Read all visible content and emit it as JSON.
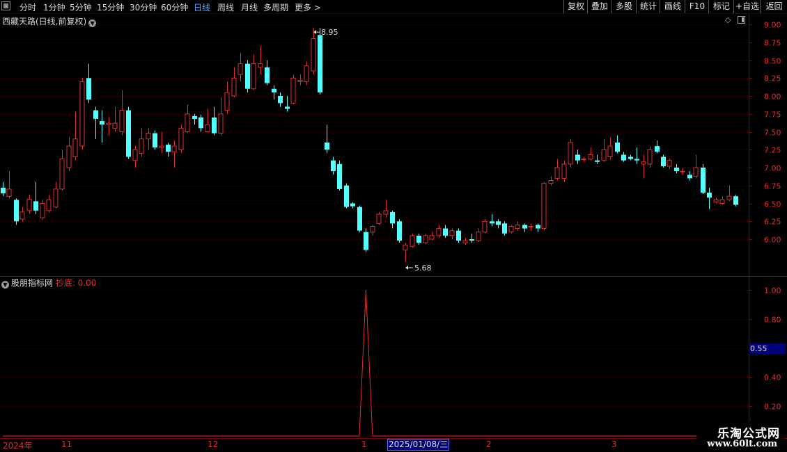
{
  "toolbar": {
    "tabs": [
      "分时",
      "1分钟",
      "5分钟",
      "15分钟",
      "30分钟",
      "60分钟",
      "日线",
      "周线",
      "月线",
      "多周期",
      "更多"
    ],
    "active_tab": "日线",
    "more_arrow": ">",
    "right_buttons": [
      "复权",
      "叠加",
      "多股",
      "统计",
      "画线",
      "F10",
      "标记",
      "+自选",
      "返回"
    ]
  },
  "main_panel": {
    "title": "西藏天路(日线,前复权)",
    "high_label": "8.95",
    "low_label": "5.68"
  },
  "indicator_panel": {
    "name": "股朋指标网",
    "series_label": "抄底:",
    "series_value": "0.00",
    "current_value": "0.55"
  },
  "time_axis": {
    "labels": [
      "2024年",
      "11",
      "12",
      "1",
      "2",
      "3"
    ],
    "cursor_date": "2025/01/08/三"
  },
  "watermark": {
    "line1": "乐淘公式网",
    "line2": "www.60lt.com"
  },
  "chart_data": [
    {
      "type": "candlestick",
      "price_axis_ticks": [
        9.0,
        8.75,
        8.5,
        8.25,
        8.0,
        7.75,
        7.5,
        7.25,
        7.0,
        6.75,
        6.5,
        6.25,
        6.0
      ],
      "ylim": [
        5.5,
        9.05
      ],
      "colors": {
        "up": "#e03030",
        "down": "#54ffff"
      },
      "candles": [
        [
          6.72,
          6.64,
          6.8,
          6.6
        ],
        [
          6.6,
          6.7,
          6.95,
          6.57
        ],
        [
          6.55,
          6.25,
          6.57,
          6.2
        ],
        [
          6.28,
          6.38,
          6.45,
          6.25
        ],
        [
          6.4,
          6.56,
          6.62,
          6.36
        ],
        [
          6.53,
          6.4,
          6.8,
          6.35
        ],
        [
          6.3,
          6.5,
          6.55,
          6.27
        ],
        [
          6.4,
          6.55,
          6.62,
          6.37
        ],
        [
          6.45,
          6.7,
          6.8,
          6.43
        ],
        [
          6.7,
          7.12,
          7.25,
          6.68
        ],
        [
          7.0,
          7.3,
          7.42,
          6.95
        ],
        [
          7.15,
          7.4,
          7.78,
          7.1
        ],
        [
          7.3,
          8.2,
          8.25,
          7.25
        ],
        [
          8.25,
          7.95,
          8.45,
          7.9
        ],
        [
          7.8,
          7.68,
          7.85,
          7.4
        ],
        [
          7.65,
          7.6,
          7.8,
          7.35
        ],
        [
          7.6,
          7.62,
          7.7,
          7.45
        ],
        [
          7.55,
          7.62,
          7.85,
          7.5
        ],
        [
          7.5,
          7.8,
          8.08,
          7.45
        ],
        [
          7.8,
          7.15,
          7.85,
          7.12
        ],
        [
          7.1,
          7.25,
          7.3,
          7.0
        ],
        [
          7.2,
          7.4,
          7.55,
          7.15
        ],
        [
          7.4,
          7.48,
          7.55,
          7.25
        ],
        [
          7.48,
          7.28,
          7.52,
          7.25
        ],
        [
          7.28,
          7.3,
          7.5,
          7.2
        ],
        [
          7.32,
          7.22,
          7.35,
          7.15
        ],
        [
          7.22,
          7.3,
          7.38,
          7.0
        ],
        [
          7.25,
          7.55,
          7.6,
          7.2
        ],
        [
          7.5,
          7.75,
          7.88,
          7.48
        ],
        [
          7.72,
          7.68,
          7.75,
          7.6
        ],
        [
          7.7,
          7.55,
          7.74,
          7.5
        ],
        [
          7.5,
          7.6,
          7.82,
          7.48
        ],
        [
          7.7,
          7.48,
          7.85,
          7.45
        ],
        [
          7.48,
          7.75,
          7.98,
          7.45
        ],
        [
          7.8,
          8.05,
          8.2,
          7.75
        ],
        [
          8.0,
          8.25,
          8.4,
          7.98
        ],
        [
          8.3,
          8.45,
          8.6,
          8.2
        ],
        [
          8.45,
          8.1,
          8.5,
          8.05
        ],
        [
          8.1,
          8.45,
          8.58,
          8.08
        ],
        [
          8.4,
          8.45,
          8.7,
          8.3
        ],
        [
          8.4,
          8.18,
          8.5,
          8.15
        ],
        [
          8.1,
          8.05,
          8.15,
          7.95
        ],
        [
          8.0,
          7.9,
          8.05,
          7.85
        ],
        [
          7.85,
          7.82,
          8.0,
          7.78
        ],
        [
          7.9,
          8.25,
          8.3,
          7.88
        ],
        [
          8.2,
          8.22,
          8.3,
          8.15
        ],
        [
          8.2,
          8.42,
          8.48,
          8.15
        ],
        [
          8.35,
          8.8,
          8.95,
          8.3
        ],
        [
          8.85,
          8.05,
          8.95,
          8.02
        ],
        [
          7.35,
          7.25,
          7.6,
          7.2
        ],
        [
          7.1,
          6.95,
          7.15,
          6.9
        ],
        [
          7.05,
          6.7,
          7.1,
          6.68
        ],
        [
          6.75,
          6.45,
          6.78,
          6.43
        ],
        [
          6.5,
          6.46,
          6.52,
          6.43
        ],
        [
          6.45,
          6.12,
          6.47,
          6.1
        ],
        [
          6.1,
          5.85,
          6.15,
          5.82
        ],
        [
          6.1,
          6.18,
          6.2,
          6.05
        ],
        [
          6.22,
          6.35,
          6.38,
          6.2
        ],
        [
          6.35,
          6.4,
          6.55,
          6.3
        ],
        [
          6.38,
          6.22,
          6.4,
          6.15
        ],
        [
          6.25,
          5.98,
          6.28,
          5.95
        ],
        [
          5.85,
          5.92,
          5.95,
          5.68
        ],
        [
          5.9,
          6.05,
          6.08,
          5.88
        ],
        [
          6.05,
          5.95,
          6.08,
          5.92
        ],
        [
          5.95,
          6.05,
          6.08,
          5.93
        ],
        [
          6.0,
          6.05,
          6.1,
          5.98
        ],
        [
          6.05,
          6.15,
          6.2,
          6.02
        ],
        [
          6.15,
          6.05,
          6.2,
          6.02
        ],
        [
          6.05,
          6.12,
          6.15,
          6.0
        ],
        [
          6.12,
          5.98,
          6.15,
          5.95
        ],
        [
          5.95,
          5.98,
          6.02,
          5.92
        ],
        [
          6.0,
          5.98,
          6.08,
          5.95
        ],
        [
          5.98,
          6.1,
          6.15,
          5.96
        ],
        [
          6.1,
          6.25,
          6.28,
          6.08
        ],
        [
          6.25,
          6.22,
          6.35,
          6.18
        ],
        [
          6.25,
          6.2,
          6.28,
          6.15
        ],
        [
          6.22,
          6.08,
          6.25,
          6.05
        ],
        [
          6.1,
          6.18,
          6.2,
          6.08
        ],
        [
          6.15,
          6.2,
          6.25,
          6.12
        ],
        [
          6.2,
          6.15,
          6.22,
          6.1
        ],
        [
          6.18,
          6.18,
          6.22,
          6.12
        ],
        [
          6.2,
          6.15,
          6.22,
          6.1
        ],
        [
          6.15,
          6.78,
          6.8,
          6.12
        ],
        [
          6.78,
          6.82,
          6.88,
          6.75
        ],
        [
          6.85,
          7.0,
          7.12,
          6.82
        ],
        [
          6.85,
          7.05,
          7.1,
          6.8
        ],
        [
          7.05,
          7.35,
          7.4,
          7.0
        ],
        [
          7.18,
          7.1,
          7.25,
          7.05
        ],
        [
          7.12,
          7.12,
          7.15,
          7.08
        ],
        [
          7.12,
          7.18,
          7.28,
          7.1
        ],
        [
          7.1,
          7.08,
          7.18,
          7.05
        ],
        [
          7.1,
          7.25,
          7.4,
          7.08
        ],
        [
          7.15,
          7.3,
          7.42,
          7.12
        ],
        [
          7.35,
          7.22,
          7.45,
          7.2
        ],
        [
          7.18,
          7.1,
          7.22,
          7.08
        ],
        [
          7.15,
          7.12,
          7.18,
          7.1
        ],
        [
          7.12,
          7.1,
          7.28,
          7.05
        ],
        [
          7.05,
          7.08,
          7.18,
          6.85
        ],
        [
          7.05,
          7.25,
          7.3,
          7.0
        ],
        [
          7.3,
          7.22,
          7.38,
          7.2
        ],
        [
          7.15,
          7.02,
          7.18,
          7.0
        ],
        [
          7.02,
          7.1,
          7.12,
          6.98
        ],
        [
          7.0,
          6.95,
          7.05,
          6.92
        ],
        [
          6.95,
          6.95,
          7.0,
          6.9
        ],
        [
          6.9,
          6.85,
          6.95,
          6.82
        ],
        [
          6.88,
          7.0,
          7.18,
          6.85
        ],
        [
          7.0,
          6.65,
          7.05,
          6.63
        ],
        [
          6.65,
          6.58,
          6.72,
          6.42
        ],
        [
          6.52,
          6.55,
          6.58,
          6.5
        ],
        [
          6.5,
          6.55,
          6.6,
          6.48
        ],
        [
          6.55,
          6.6,
          6.75,
          6.53
        ],
        [
          6.6,
          6.48,
          6.62,
          6.46
        ]
      ]
    },
    {
      "type": "line",
      "series": [
        {
          "name": "抄底",
          "color": "#e03030"
        }
      ],
      "y_axis_ticks": [
        1.0,
        0.8,
        0.6,
        0.4,
        0.2
      ],
      "ylim": [
        0,
        1.12
      ],
      "values": [
        0,
        0,
        0,
        0,
        0,
        0,
        0,
        0,
        0,
        0,
        0,
        0,
        0,
        0,
        0,
        0,
        0,
        0,
        0,
        0,
        0,
        0,
        0,
        0,
        0,
        0,
        0,
        0,
        0,
        0,
        0,
        0,
        0,
        0,
        0,
        0,
        0,
        0,
        0,
        0,
        0,
        0,
        0,
        0,
        0,
        0,
        0,
        0,
        0,
        0,
        0,
        0,
        0,
        0,
        0,
        1,
        0,
        0,
        0,
        0,
        0,
        0,
        0,
        0,
        0,
        0,
        0,
        0,
        0,
        0,
        0,
        0,
        0,
        0,
        0,
        0,
        0,
        0,
        0,
        0,
        0,
        0,
        0,
        0,
        0,
        0,
        0,
        0,
        0,
        0,
        0,
        0,
        0,
        0,
        0,
        0,
        0,
        0,
        0,
        0,
        0,
        0,
        0,
        0,
        0,
        0,
        0,
        0,
        0,
        0,
        0,
        0,
        0
      ]
    }
  ]
}
